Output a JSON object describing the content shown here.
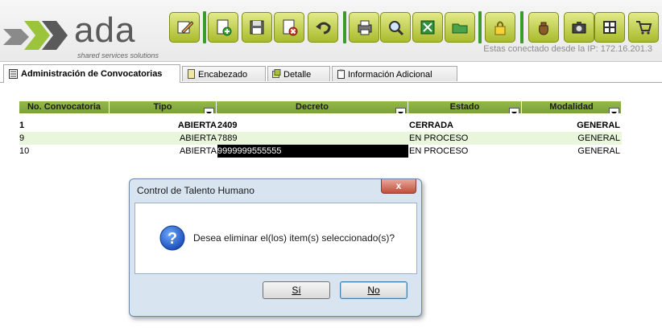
{
  "brand": {
    "logo_text": "ada",
    "tagline": "shared services solutions"
  },
  "toolbar": {
    "buttons": [
      {
        "icon": "edit-icon",
        "label": ""
      },
      {
        "icon": "new-icon",
        "label": ""
      },
      {
        "icon": "save-icon",
        "label": ""
      },
      {
        "icon": "delete-icon",
        "label": ""
      },
      {
        "icon": "undo-icon",
        "label": ""
      },
      {
        "icon": "print-icon",
        "label": ""
      },
      {
        "icon": "search-icon",
        "label": ""
      },
      {
        "icon": "export-icon",
        "label": ""
      },
      {
        "icon": "folder-icon",
        "label": ""
      },
      {
        "icon": "lock-icon",
        "label": ""
      },
      {
        "icon": "money-bag-icon",
        "label": ""
      },
      {
        "icon": "camera-icon",
        "label": ""
      },
      {
        "icon": "grid-icon",
        "label": ""
      },
      {
        "icon": "cart-icon",
        "label": ""
      }
    ],
    "accent_color": "#a9bb2c",
    "separator_color": "#3c9a2d"
  },
  "status": {
    "ip_text": "Estas conectado desde la IP: 172.16.201.3"
  },
  "tabs": [
    {
      "label": "Administración de Convocatorias",
      "active": true
    },
    {
      "label": "Encabezado",
      "active": false
    },
    {
      "label": "Detalle",
      "active": false
    },
    {
      "label": "Información Adicional",
      "active": false
    }
  ],
  "grid": {
    "header_color": "#84ac3f",
    "columns": [
      "No. Convocatoria",
      "Tipo",
      "Decreto",
      "Estado",
      "Modalidad"
    ],
    "rows": [
      {
        "no": "1",
        "tipo": "ABIERTA",
        "decreto": "2409",
        "estado": "CERRADA",
        "modalidad": "GENERAL",
        "style": "bold"
      },
      {
        "no": "9",
        "tipo": "ABIERTA",
        "decreto": "7889",
        "estado": "EN PROCESO",
        "modalidad": "GENERAL",
        "style": "highlight"
      },
      {
        "no": "10",
        "tipo": "ABIERTA",
        "decreto": "9999999555555",
        "estado": "EN PROCESO",
        "modalidad": "GENERAL",
        "style": "selected"
      }
    ]
  },
  "dialog": {
    "title": "Control de Talento Humano",
    "close_label": "x",
    "message": "Desea eliminar el(los) item(s) seleccionado(s)?",
    "yes_label": "Sí",
    "no_label": "No"
  }
}
